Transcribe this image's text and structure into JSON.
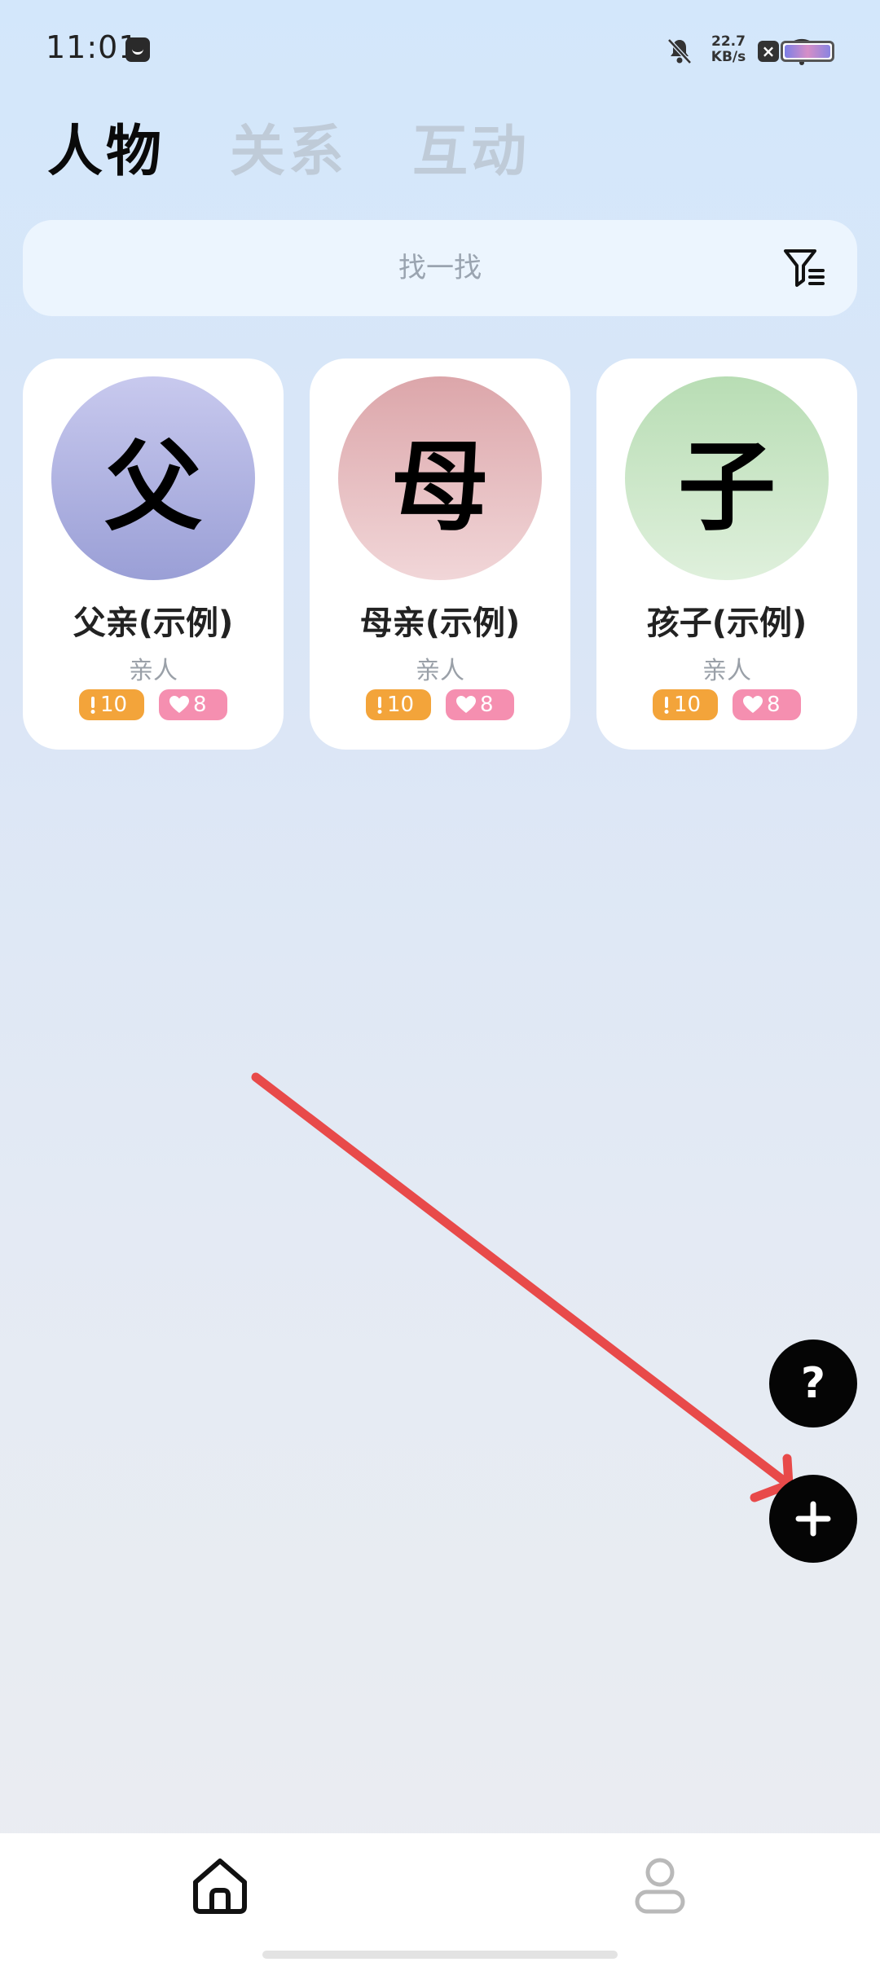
{
  "status_bar": {
    "time": "11:01",
    "speed_value": "22.7",
    "speed_unit": "KB/s",
    "icons": [
      "app-notification-icon",
      "bell-mute-icon",
      "close-box-icon",
      "wifi-icon",
      "battery-icon"
    ]
  },
  "tabs": [
    {
      "label": "人物",
      "active": true
    },
    {
      "label": "关系",
      "active": false
    },
    {
      "label": "互动",
      "active": false
    }
  ],
  "search": {
    "placeholder": "找一找",
    "filter_icon": "filter-icon"
  },
  "people": [
    {
      "avatar_char": "父",
      "name": "父亲(示例)",
      "relation": "亲人",
      "alert_count": "10",
      "heart_count": "8"
    },
    {
      "avatar_char": "母",
      "name": "母亲(示例)",
      "relation": "亲人",
      "alert_count": "10",
      "heart_count": "8"
    },
    {
      "avatar_char": "子",
      "name": "孩子(示例)",
      "relation": "亲人",
      "alert_count": "10",
      "heart_count": "8"
    }
  ],
  "fab": {
    "help_label": "?",
    "add_icon": "plus-icon"
  },
  "bottom_nav": {
    "items": [
      {
        "icon": "home-icon",
        "active": true
      },
      {
        "icon": "profile-icon",
        "active": false
      }
    ]
  },
  "colors": {
    "alert_badge": "#f3a43a",
    "heart_badge": "#f58fb0",
    "annotation_arrow": "#e84a4a",
    "fab": "#050505",
    "avatar_father": [
      "#c8c9ee",
      "#9a9fd6"
    ],
    "avatar_mother": [
      "#dca6aa",
      "#f1d6d8"
    ],
    "avatar_child": [
      "#b8ddb4",
      "#dff0dc"
    ]
  }
}
